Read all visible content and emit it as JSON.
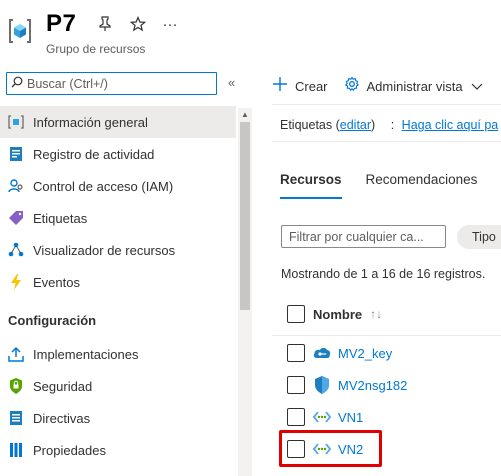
{
  "header": {
    "title": "P7",
    "subtitle": "Grupo de recursos",
    "pin_icon": "pin-icon",
    "star_icon": "star-icon",
    "more_label": "···"
  },
  "sidebar": {
    "search_placeholder": "Buscar (Ctrl+/)",
    "collapse_label": "«",
    "items": [
      {
        "label": "Información general",
        "icon": "overview-icon",
        "selected": true
      },
      {
        "label": "Registro de actividad",
        "icon": "activity-log-icon"
      },
      {
        "label": "Control de acceso (IAM)",
        "icon": "access-control-icon"
      },
      {
        "label": "Etiquetas",
        "icon": "tag-icon"
      },
      {
        "label": "Visualizador de recursos",
        "icon": "resource-visualizer-icon"
      },
      {
        "label": "Eventos",
        "icon": "events-icon"
      }
    ],
    "section_title": "Configuración",
    "config_items": [
      {
        "label": "Implementaciones",
        "icon": "deployments-icon"
      },
      {
        "label": "Seguridad",
        "icon": "security-icon"
      },
      {
        "label": "Directivas",
        "icon": "policies-icon"
      },
      {
        "label": "Propiedades",
        "icon": "properties-icon"
      }
    ]
  },
  "toolbar": {
    "create_label": "Crear",
    "manage_view_label": "Administrar vista"
  },
  "tags": {
    "prefix": "Etiquetas (",
    "edit_link": "editar",
    "suffix": ")",
    "separator": ":",
    "add_link": "Haga clic aquí pa"
  },
  "tabs": [
    {
      "label": "Recursos",
      "active": true
    },
    {
      "label": "Recomendaciones"
    }
  ],
  "filter": {
    "placeholder": "Filtrar por cualquier ca...",
    "type_pill": "Tipo"
  },
  "count_text": "Mostrando de 1 a 16 de 16 registros.",
  "table": {
    "column_name": "Nombre",
    "sort_icon": "↑↓",
    "rows": [
      {
        "name": "MV2_key",
        "icon": "ssh-key-icon"
      },
      {
        "name": "MV2nsg182",
        "icon": "network-security-group-icon"
      },
      {
        "name": "VN1",
        "icon": "virtual-network-icon"
      },
      {
        "name": "VN2",
        "icon": "virtual-network-icon"
      }
    ]
  },
  "colors": {
    "accent": "#0078d4",
    "highlight": "#e00000",
    "selected_bg": "#edebe9"
  }
}
